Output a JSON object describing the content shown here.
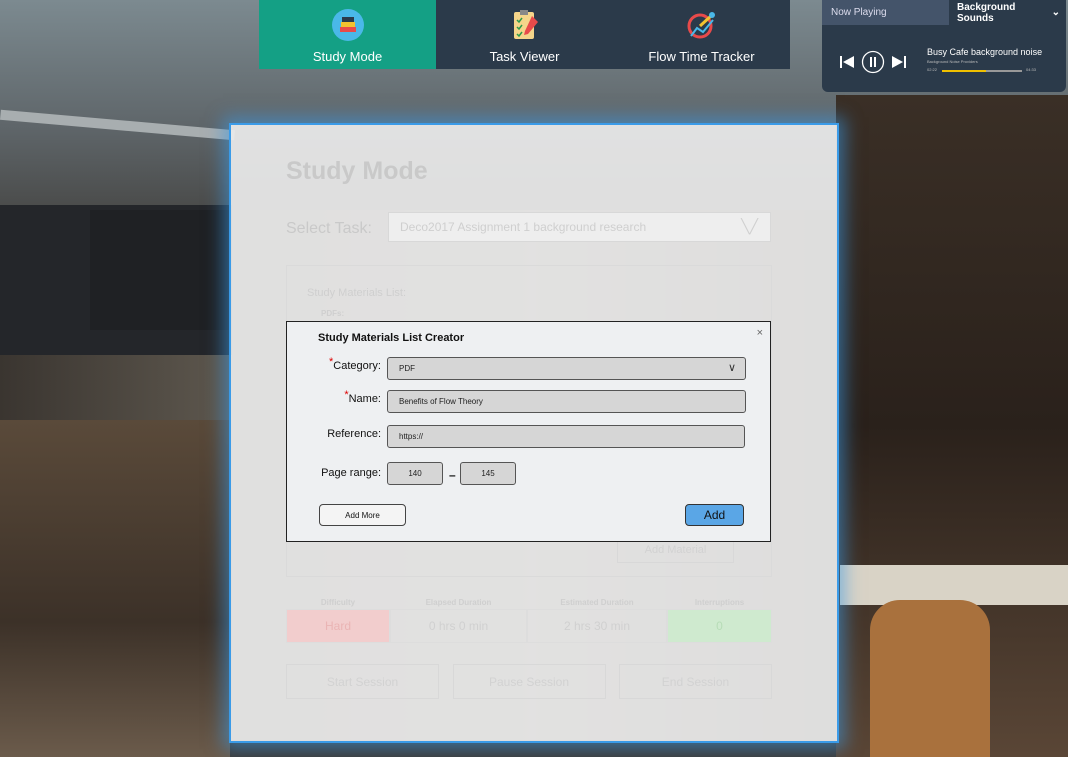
{
  "nav": {
    "items": [
      {
        "label": "Study Mode",
        "icon": "books-icon",
        "active": true
      },
      {
        "label": "Task Viewer",
        "icon": "checklist-icon",
        "active": false
      },
      {
        "label": "Flow Time Tracker",
        "icon": "chart-icon",
        "active": false
      }
    ]
  },
  "player": {
    "tab_label": "Now Playing",
    "source_label": "Background Sounds",
    "track_title": "Busy Cafe background noise",
    "track_provider": "Background Noise Providers",
    "time_elapsed": "02:22",
    "time_total": "04:33",
    "progress": 0.55
  },
  "study": {
    "title": "Study Mode",
    "select_task_label": "Select Task:",
    "selected_task": "Deco2017 Assignment 1 background research",
    "materials_label": "Study Materials List:",
    "pdfs_label": "PDFs:",
    "add_material_label": "Add Material",
    "stats": {
      "headers": [
        "Difficulty",
        "Elapsed Duration",
        "Estimated Duration",
        "Interruptions"
      ],
      "difficulty": "Hard",
      "elapsed": "0 hrs 0 min",
      "estimated": "2 hrs 30 min",
      "interruptions": "0"
    },
    "buttons": {
      "start": "Start Session",
      "pause": "Pause Session",
      "end": "End Session"
    }
  },
  "modal": {
    "title": "Study Materials List Creator",
    "close": "×",
    "category_label": "Category:",
    "category_value": "PDF",
    "name_label": "Name:",
    "name_value": "Benefits of Flow Theory",
    "reference_label": "Reference:",
    "reference_value": "https://",
    "page_range_label": "Page range:",
    "page_from": "140",
    "page_to": "145",
    "add_more_label": "Add More",
    "add_label": "Add",
    "required_mark": "*"
  },
  "colors": {
    "nav_bg": "#2b3a4a",
    "active_tab": "#14a085",
    "panel_border": "#3a9be8",
    "add_button": "#5aa6e6"
  }
}
